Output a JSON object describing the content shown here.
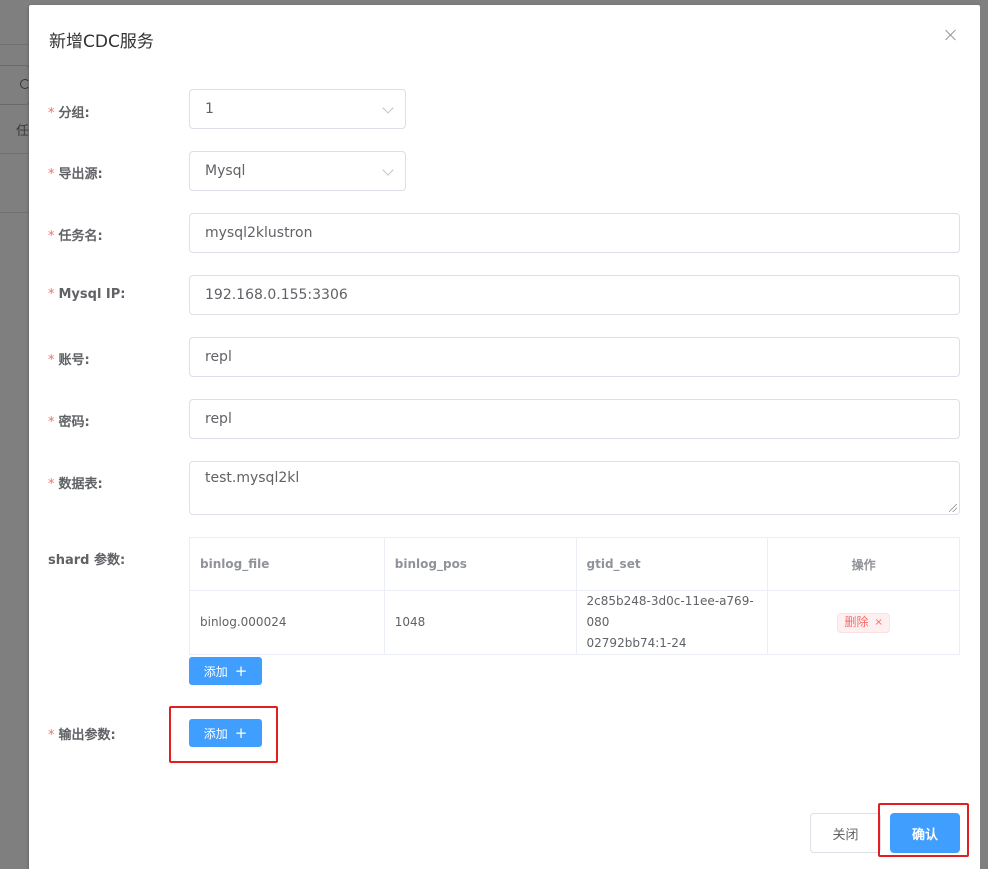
{
  "dialog": {
    "title": "新增CDC服务",
    "close_icon": "close-icon"
  },
  "background": {
    "partial_text": "任"
  },
  "form": {
    "group": {
      "label": "分组:",
      "value": "1"
    },
    "source": {
      "label": "导出源:",
      "value": "Mysql"
    },
    "task_name": {
      "label": "任务名:",
      "value": "mysql2klustron"
    },
    "mysql_ip": {
      "label": "Mysql IP:",
      "value": "192.168.0.155:3306"
    },
    "account": {
      "label": "账号:",
      "value": "repl"
    },
    "password": {
      "label": "密码:",
      "value": "repl"
    },
    "tables": {
      "label": "数据表:",
      "value": "test.mysql2kl"
    },
    "shard": {
      "label": "shard 参数:",
      "columns": [
        "binlog_file",
        "binlog_pos",
        "gtid_set",
        "操作"
      ],
      "rows": [
        {
          "binlog_file": "binlog.000024",
          "binlog_pos": "1048",
          "gtid_set_line1": "2c85b248-3d0c-11ee-a769-080",
          "gtid_set_line2": "02792bb74:1-24",
          "delete_label": "删除",
          "delete_x": "×"
        }
      ],
      "add_label": "添加"
    },
    "output": {
      "label": "输出参数:",
      "add_label": "添加"
    }
  },
  "footer": {
    "close_label": "关闭",
    "confirm_label": "确认"
  },
  "colors": {
    "primary": "#409eff",
    "required": "#f56c6c",
    "highlight": "#e02020"
  }
}
